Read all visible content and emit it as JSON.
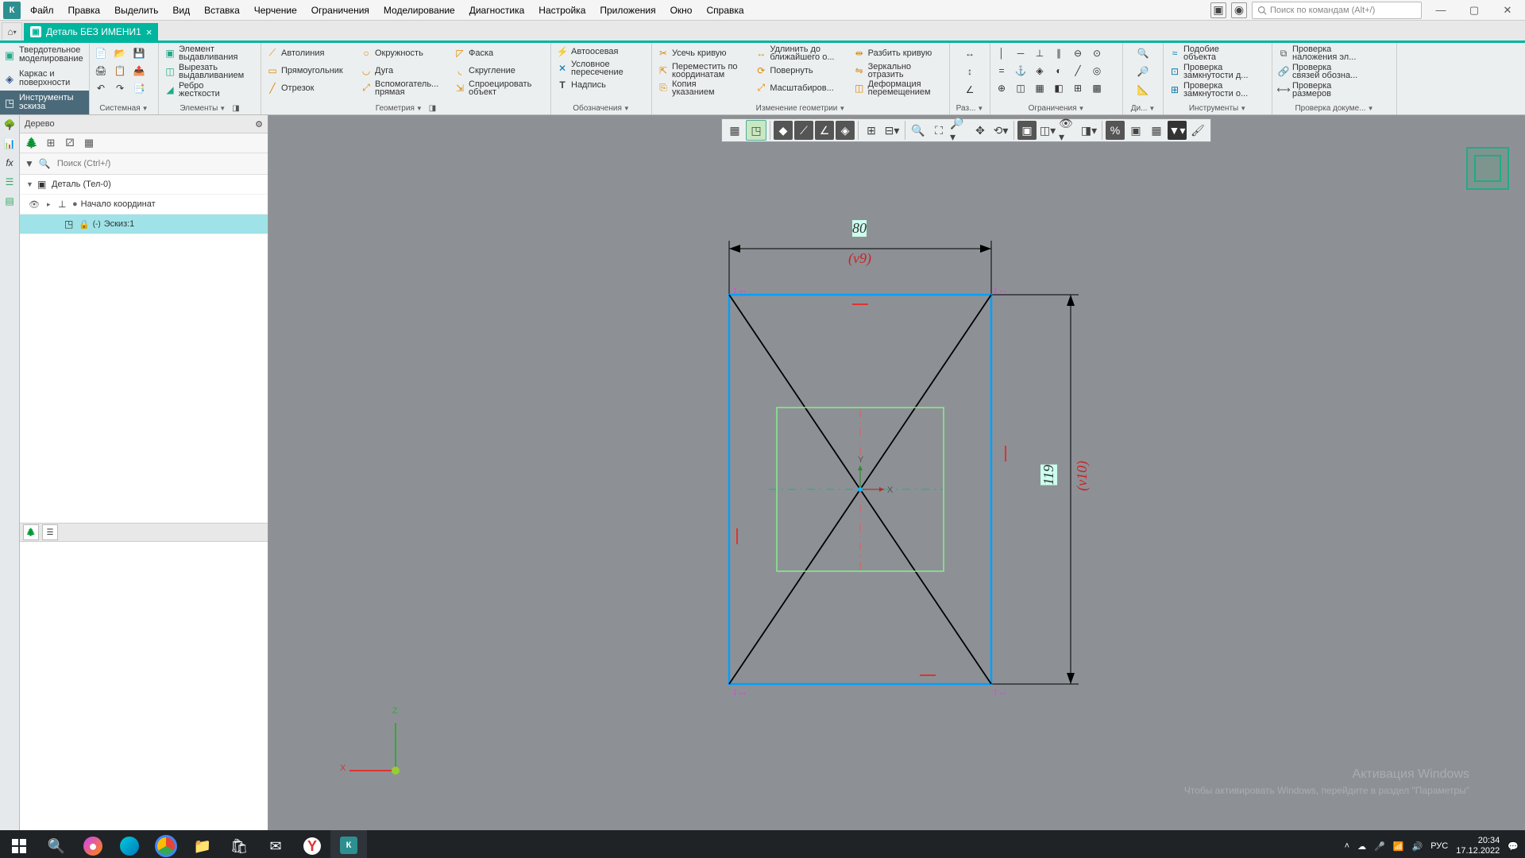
{
  "colors": {
    "accent": "#00b59e",
    "panel": "#eceff0",
    "canvas": "#8d9196",
    "select": "#9fe3e8"
  },
  "menu": [
    "Файл",
    "Правка",
    "Выделить",
    "Вид",
    "Вставка",
    "Черчение",
    "Ограничения",
    "Моделирование",
    "Диагностика",
    "Настройка",
    "Приложения",
    "Окно",
    "Справка"
  ],
  "search_placeholder": "Поиск по командам (Alt+/)",
  "doc_tab": {
    "title": "Деталь БЕЗ ИМЕНИ1"
  },
  "ribbon_side": [
    {
      "label": "Твердотельное\nмоделирование",
      "icon": "◧"
    },
    {
      "label": "Каркас и\nповерхности",
      "icon": "◇"
    },
    {
      "label": "Инструменты\nэскиза",
      "icon": "◳",
      "active": true
    }
  ],
  "ribbon_groups": {
    "system": {
      "label": "Системная"
    },
    "elements": {
      "label": "Элементы",
      "b1": "Элемент\nвыдавливания",
      "b2": "Вырезать\nвыдавливанием",
      "b3": "Ребро\nжесткости"
    },
    "geometry": {
      "label": "Геометрия",
      "b1": "Автолиния",
      "b2": "Прямоугольник",
      "b3": "Отрезок",
      "b4": "Окружность",
      "b5": "Дуга",
      "b6": "Вспомогатель...\nпрямая",
      "b7": "Фаска",
      "b8": "Скругление",
      "b9": "Спроецировать\nобъект"
    },
    "notes": {
      "label": "Обозначения",
      "b1": "Автоосевая",
      "b2": "Условное\nпересечение",
      "b3": "Надпись"
    },
    "changegeo": {
      "label": "Изменение геометрии",
      "b1": "Усечь кривую",
      "b2": "Переместить по\nкоординатам",
      "b3": "Копия\nуказанием",
      "b4": "Удлинить до\nближайшего о...",
      "b5": "Повернуть",
      "b6": "Масштабиров...",
      "b7": "Разбить кривую",
      "b8": "Зеркально\nотразить",
      "b9": "Деформация\nперемещением"
    },
    "raz": {
      "label": "Раз..."
    },
    "constraints": {
      "label": "Ограничения"
    },
    "dim": {
      "label": "Ди..."
    },
    "tools": {
      "label": "Инструменты",
      "b1": "Подобие\nобъекта",
      "b2": "Проверка\nзамкнутости д...",
      "b3": "Проверка\nзамкнутости о..."
    },
    "doccheck": {
      "label": "Проверка докуме...",
      "b1": "Проверка\nналожения эл...",
      "b2": "Проверка\nсвязей обозна...",
      "b3": "Проверка\nразмеров"
    }
  },
  "panel": {
    "title": "Дерево",
    "search": "Поиск (Ctrl+/)"
  },
  "tree": {
    "root": "Деталь (Тел-0)",
    "origin": "Начало координат",
    "sketch": "Эскиз:1"
  },
  "dims": {
    "h": "80",
    "h_var": "(v9)",
    "v": "119",
    "v_var": "(v10)"
  },
  "axes": {
    "x": "X",
    "y": "Y",
    "z": "Z"
  },
  "watermark": {
    "l1": "Активация Windows",
    "l2": "Чтобы активировать Windows, перейдите в раздел \"Параметры\""
  },
  "tray": {
    "lang": "РУС",
    "time": "20:34",
    "date": "17.12.2022"
  }
}
